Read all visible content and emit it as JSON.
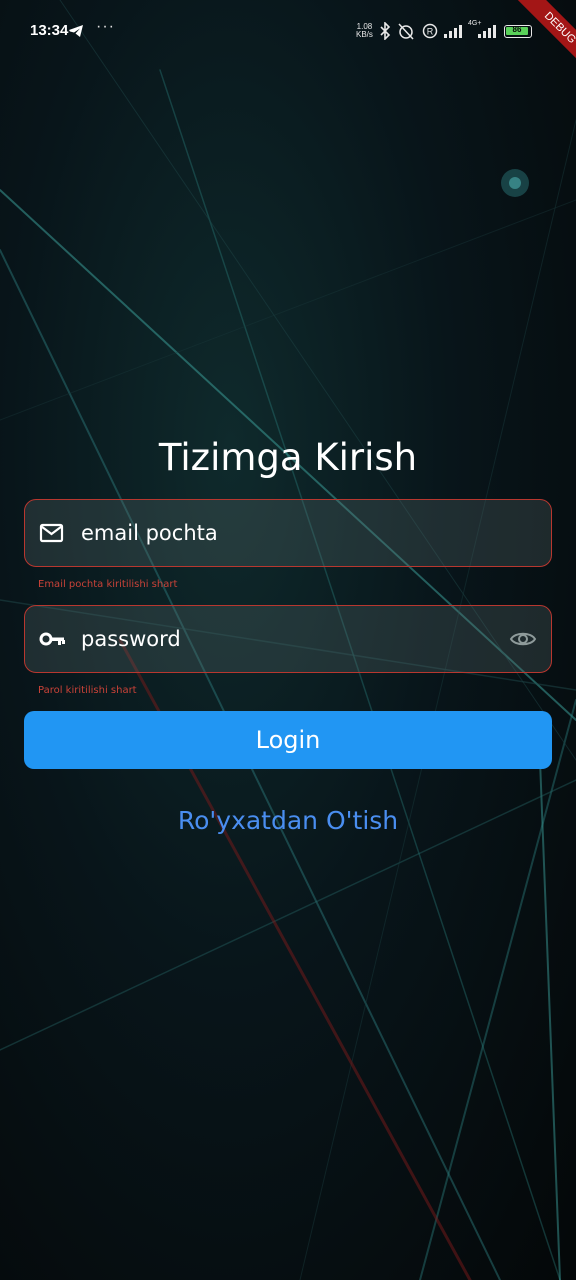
{
  "status_bar": {
    "time": "13:34",
    "more": "···",
    "net_speed_value": "1.08",
    "net_speed_unit": "KB/s",
    "network": "4G+",
    "battery_level": "86"
  },
  "debug_banner": "DEBUG",
  "login": {
    "title": "Tizimga Kirish",
    "email_placeholder": "email pochta",
    "email_error": "Email pochta kiritilishi shart",
    "password_placeholder": "password",
    "password_error": "Parol kiritilishi shart",
    "login_label": "Login",
    "register_label": "Ro'yxatdan O'tish"
  },
  "colors": {
    "accent": "#2196f3",
    "link": "#4a8ef0",
    "error": "#c94238",
    "debug": "#a31616"
  }
}
